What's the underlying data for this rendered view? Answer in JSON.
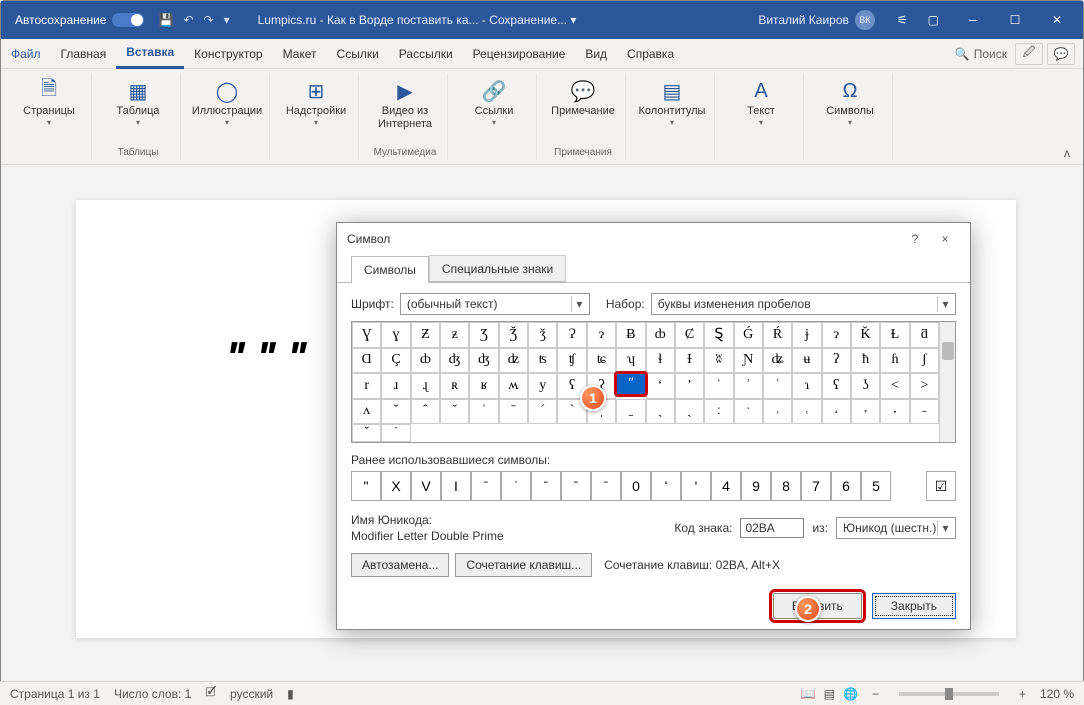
{
  "titlebar": {
    "autosave": "Автосохранение",
    "title": "Lumpics.ru - Как в Ворде поставить ка... - Сохранение... ▾",
    "user": "Виталий Каиров",
    "initials": "ВК"
  },
  "tabs": {
    "file": "Файл",
    "home": "Главная",
    "insert": "Вставка",
    "design": "Конструктор",
    "layout": "Макет",
    "refs": "Ссылки",
    "mail": "Рассылки",
    "review": "Рецензирование",
    "view": "Вид",
    "help": "Справка",
    "search": "Поиск"
  },
  "ribbon": {
    "pages": "Страницы",
    "table": "Таблица",
    "illus": "Иллюстрации",
    "addins": "Надстройки",
    "video": "Видео из Интернета",
    "links": "Ссылки",
    "comment": "Примечание",
    "headfoot": "Колонтитулы",
    "text": "Текст",
    "symbols": "Символы",
    "g_tables": "Таблицы",
    "g_media": "Мультимедиа",
    "g_comments": "Примечания"
  },
  "document": {
    "text": "ʺ ʺ ʺ"
  },
  "dialog": {
    "title": "Символ",
    "help": "?",
    "close": "×",
    "tab1": "Символы",
    "tab2": "Специальные знаки",
    "font_lbl": "Шрифт:",
    "font_val": "(обычный текст)",
    "set_lbl": "Набор:",
    "set_val": "буквы изменения пробелов",
    "grid": [
      [
        "Ɣ",
        "ɣ",
        "Ƶ",
        "ƶ",
        "Ʒ",
        "Ǯ",
        "ǯ",
        "Ɂ",
        "ɂ",
        "Ƀ",
        "ȸ",
        "Ȼ",
        "Ȿ",
        "Ǵ",
        "Ŕ",
        "ɉ",
        "ɂ",
        "Ǩ",
        "Ɫ",
        "ƌ"
      ],
      [
        "Ɑ",
        "Ç",
        "ȸ",
        "ʤ",
        "ʤ",
        "ʣ",
        "ʦ",
        "ʧ",
        "ʨ",
        "ʮ",
        "ɬ",
        "Ɨ",
        "ʬ",
        "Ɲ",
        "ʥ",
        "ʉ",
        "ʔ",
        "ħ",
        "ɦ",
        "ʃ",
        "r"
      ],
      [
        "ɹ",
        "ɻ",
        "ʀ",
        "ʁ",
        "ʍ",
        "y",
        "ʕ",
        "ʔ",
        "ʺ",
        "ʻ",
        "ʼ",
        "ˈ",
        "ʾ",
        "ʿ",
        "ɿ",
        "ʕ",
        "ʖ",
        "<",
        ">",
        "ʌ",
        "ˇ"
      ],
      [
        "ˆ",
        "ˇ",
        "ˈ",
        "ˉ",
        "ˊ",
        "ˋ",
        "ˌ",
        "ˍ",
        "ˎ",
        "ˏ",
        "ː",
        "ˑ",
        "˒",
        "˓",
        "˔",
        "˕",
        "˖",
        "˗",
        "˘",
        "˙"
      ]
    ],
    "selected_row": 2,
    "selected_col": 8,
    "recent_lbl": "Ранее использовавшиеся символы:",
    "recent": [
      "ʺ",
      "X",
      "V",
      "I",
      "ˉ",
      "ˈ",
      "ˉ",
      "ˉ",
      "ˉ",
      "0",
      "ʻ",
      "'",
      "4",
      "9",
      "8",
      "7",
      "6",
      "5"
    ],
    "recent_last": "☑",
    "uname_lbl": "Имя Юникода:",
    "uname_val": "Modifier Letter Double Prime",
    "code_lbl": "Код знака:",
    "code_val": "02BA",
    "from_lbl": "из:",
    "from_val": "Юникод (шестн.)",
    "auto": "Автозамена...",
    "short": "Сочетание клавиш...",
    "short_lbl": "Сочетание клавиш: 02BA, Alt+X",
    "insert": "Вставить",
    "close_btn": "Закрыть"
  },
  "status": {
    "page": "Страница 1 из 1",
    "words": "Число слов: 1",
    "lang": "русский",
    "zoom": "120 %"
  },
  "callouts": {
    "c1": "1",
    "c2": "2"
  }
}
